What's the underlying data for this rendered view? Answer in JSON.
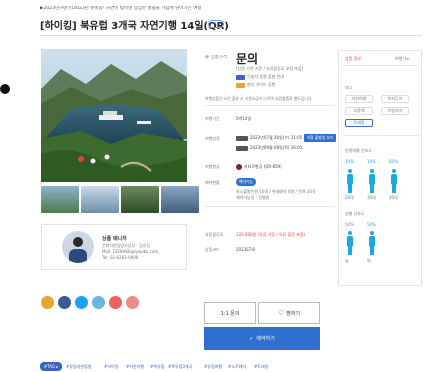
{
  "header": {
    "subtitle": "▶2023년하반기(2023년 준비중! 자연이 빚어낸 장엄한 풍광을 가슴에 담아가는 여정",
    "title": "[하이킹] 북유럽 3개국 자연기행 14일(QR)",
    "badge": "보기"
  },
  "product": {
    "code_label": "좋 상품가격",
    "price_label": "문의",
    "notes": [
      "(상품 가격 기준 / 유류할증료 포함 포함)",
      "인솔자 동행 출발 안내",
      "현지 가이드 동행"
    ],
    "rows": [
      {
        "label": "여행기간",
        "value": "5박14일"
      },
      {
        "label": "여행일정",
        "value": "2023년07월 26일(수) 21:05",
        "value2": "2023년09월 08일(목) 16:05"
      },
      {
        "label": "여행항공",
        "value": "카타르항공 (QR-859)"
      },
      {
        "label": "예약현황",
        "value": "예약가능"
      },
      {
        "label": "유류할증료",
        "value": "102,000원 (유류 기준 / 유류 할증 포함)"
      },
      {
        "label": "상품코드",
        "value": "2023ST-8"
      }
    ],
    "mini_button": "이용 출발일 보기",
    "reserve_status": "최소출발인원 10명 / 현재예약 0명 / 잔여 20석",
    "reserve_status2": "예약가능일 : 진행중",
    "note_line": "여행상품은 소인 출발 시 이용요금이 다르며 유류할증료 별도입니다."
  },
  "manager": {
    "title": "상품 매니저",
    "name": "문화자연탐방사업부 : 김호진",
    "email": "Mail: CEOHIKE@lywebs.com",
    "phone": "Tel: 02-6263-0900"
  },
  "actions": {
    "inquiry": "1:1 문의",
    "wishlist": "찜하기",
    "reserve": "예약하기"
  },
  "sidebar": {
    "title": "상품 정보",
    "more": "여행가 ▸",
    "tag_title": "태그",
    "tags": [
      "자연여행",
      "현지투어",
      "지중해",
      "히말라야",
      "트레킹"
    ],
    "stats_title": "연령대별 선호도",
    "percents": [
      "10%",
      "10%",
      "60%"
    ],
    "ages": [
      "20대",
      "30대",
      "40대"
    ],
    "gender_title": "성별 선호도",
    "gender_pcts": [
      "50%",
      "50%"
    ],
    "genders": [
      "남",
      "여"
    ]
  },
  "bottom_tags": {
    "label": "#TAG ▸",
    "items": [
      "#유럽자연탐험",
      "#하이킹",
      "#자연기행",
      "#북유럽",
      "#북유럽3개국",
      "#유럽여행",
      "#노르웨이",
      "#트레킹"
    ]
  },
  "colors": {
    "blue": "#2f6fd0",
    "accent_blue": "#3a63c7",
    "navy": "#0a2a5c"
  }
}
